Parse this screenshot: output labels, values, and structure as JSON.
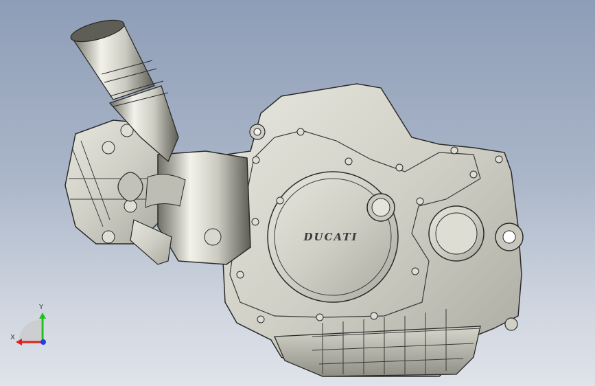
{
  "viewport": {
    "background_top": "#8e9db7",
    "background_bottom": "#dfe3ea"
  },
  "model": {
    "brand_text": "DUCATI",
    "body_color": "#d0d0c6",
    "edge_color": "#2a2a2a"
  },
  "triad": {
    "x_label": "X",
    "y_label": "Y",
    "x_color": "#e02020",
    "y_color": "#20c020",
    "z_color": "#2040e0"
  }
}
